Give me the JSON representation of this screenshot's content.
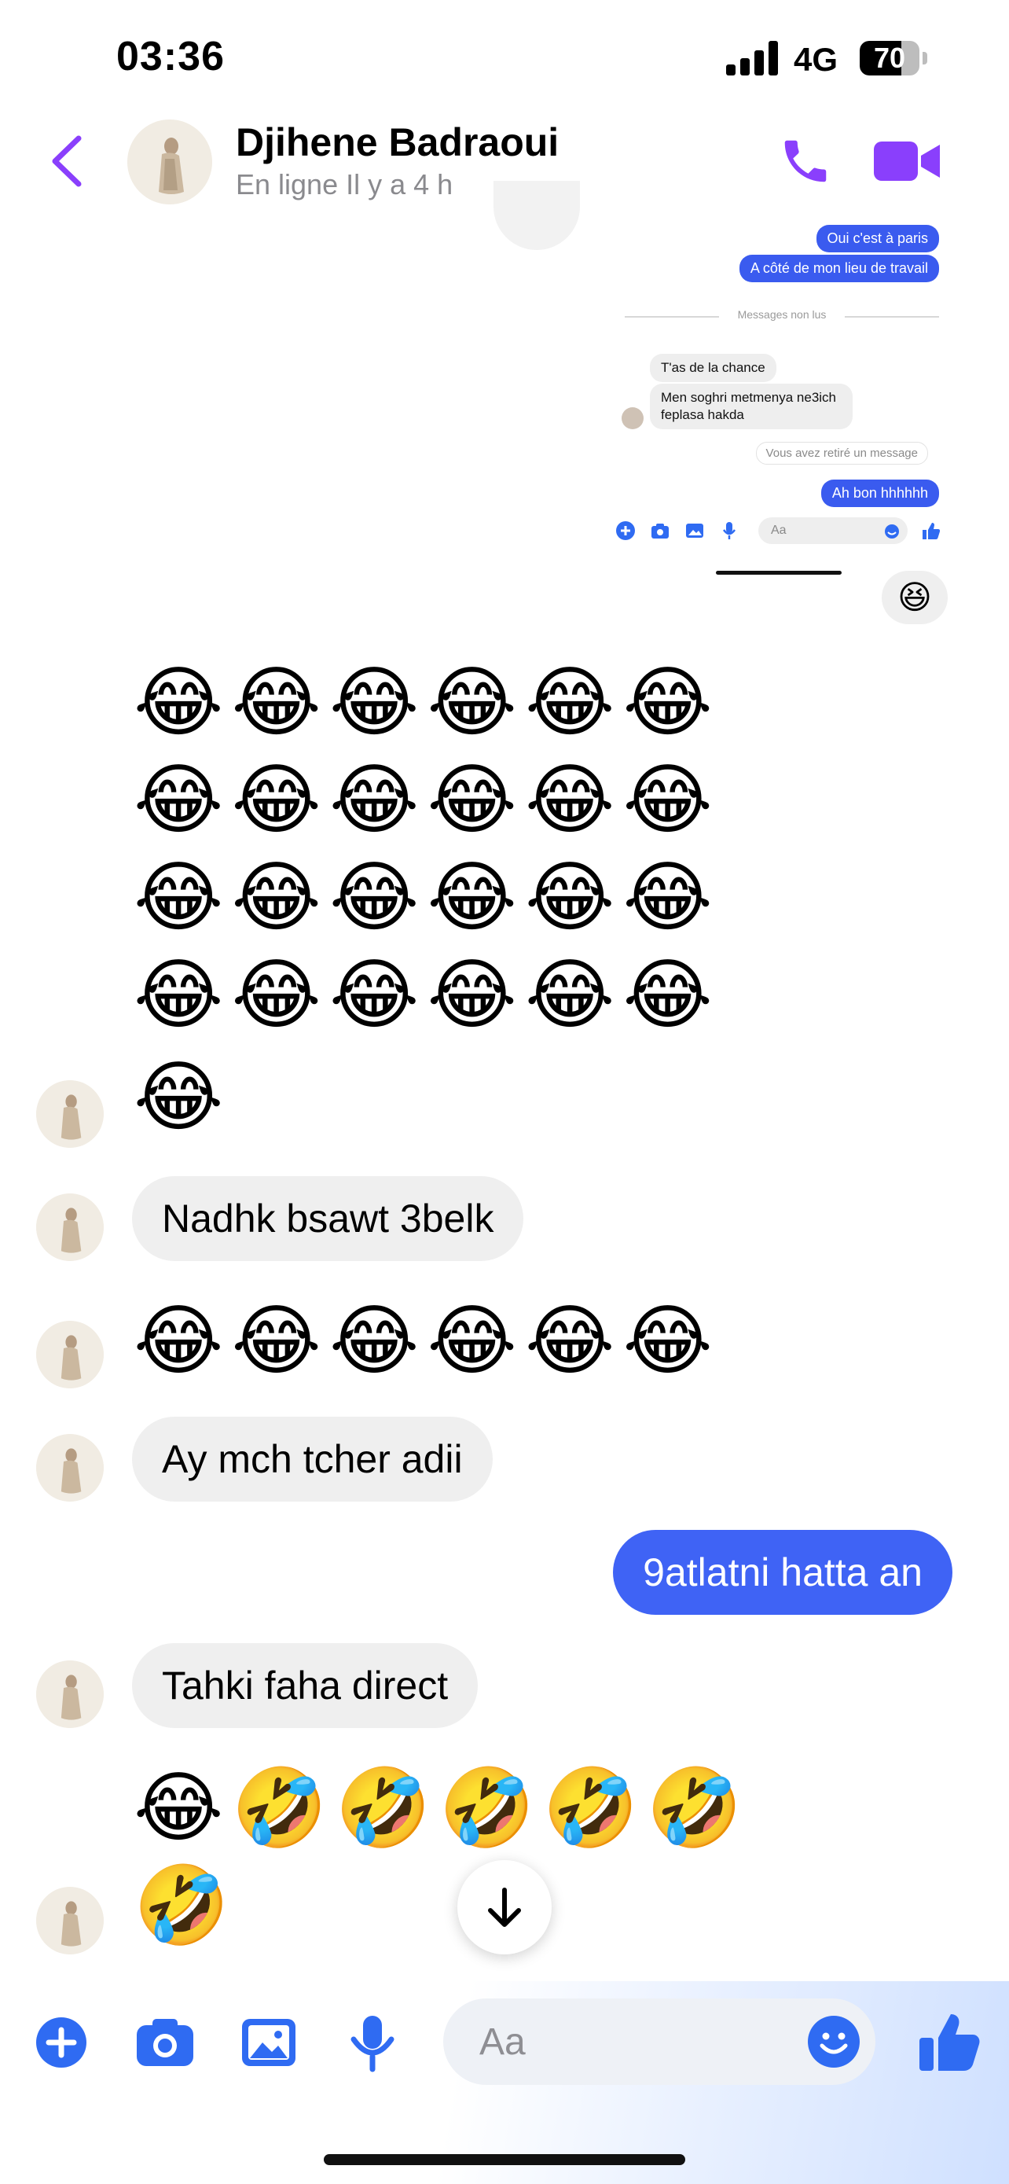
{
  "status_bar": {
    "time": "03:36",
    "network": "4G",
    "battery": "70",
    "battery_level": 0.7
  },
  "header": {
    "contact_name": "Djihene Badraoui",
    "presence": "En ligne Il y a 4 h",
    "icons": [
      "back-chevron-icon",
      "phone-icon",
      "video-camera-icon"
    ],
    "accent_color": "#8a3ffc"
  },
  "shared_screenshot": {
    "top_partial": "Oui c'est à paris",
    "out_messages": [
      "Oui c'est à paris",
      "A côté de mon lieu de travail"
    ],
    "divider": "Messages non lus",
    "in_messages": [
      "T'as de la chance",
      "Men soghri metmenya ne3ich feplasa hakda"
    ],
    "removed_note": "Vous avez retiré un message",
    "last_out": "Ah bon hhhhhh",
    "input_placeholder": "Aa"
  },
  "reaction_emoji": "😆",
  "messages": {
    "laugh_row": "😂😂😂😂😂😂",
    "laugh_single": "😂",
    "msg1": "Nadhk bsawt 3belk",
    "msg2": "Ay mch tcher adii",
    "msg_out": "9atlatni hatta an",
    "msg3": "Tahki faha direct",
    "mixed_row": "😂🤣🤣🤣🤣🤣",
    "rofl_single": "🤣"
  },
  "composer": {
    "placeholder": "Aa",
    "icons": [
      "plus-icon",
      "camera-icon",
      "image-icon",
      "microphone-icon",
      "emoji-icon",
      "thumbs-up-icon"
    ],
    "icon_color": "#2f6bf2"
  }
}
